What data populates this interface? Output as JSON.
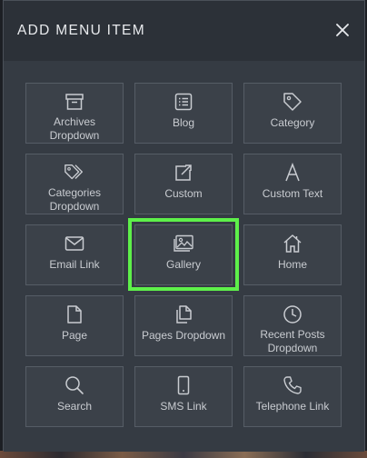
{
  "modal": {
    "title": "ADD MENU ITEM",
    "close_icon": "close-icon"
  },
  "items": [
    {
      "label": "Archives\nDropdown",
      "icon": "archive-icon"
    },
    {
      "label": "Blog",
      "icon": "list-icon"
    },
    {
      "label": "Category",
      "icon": "tag-icon"
    },
    {
      "label": "Categories\nDropdown",
      "icon": "tags-icon"
    },
    {
      "label": "Custom",
      "icon": "external-link-icon"
    },
    {
      "label": "Custom Text",
      "icon": "text-a-icon"
    },
    {
      "label": "Email Link",
      "icon": "envelope-icon"
    },
    {
      "label": "Gallery",
      "icon": "images-icon"
    },
    {
      "label": "Home",
      "icon": "home-icon"
    },
    {
      "label": "Page",
      "icon": "file-icon"
    },
    {
      "label": "Pages Dropdown",
      "icon": "files-icon"
    },
    {
      "label": "Recent Posts\nDropdown",
      "icon": "clock-icon"
    },
    {
      "label": "Search",
      "icon": "search-icon"
    },
    {
      "label": "SMS Link",
      "icon": "mobile-icon"
    },
    {
      "label": "Telephone Link",
      "icon": "phone-icon"
    }
  ],
  "colors": {
    "highlight": "#5ef04a",
    "header_bg": "#2c3138",
    "tile_bg": "#3b4149",
    "text": "#c9ccd1"
  }
}
